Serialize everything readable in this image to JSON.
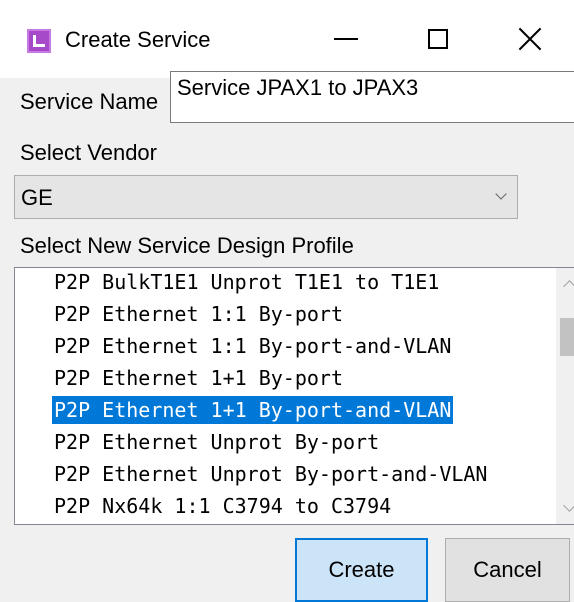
{
  "window": {
    "title": "Create Service",
    "icon": "app-icon"
  },
  "form": {
    "service_name_label": "Service Name",
    "service_name_value": "Service JPAX1 to JPAX3",
    "vendor_label": "Select Vendor",
    "vendor_value": "GE",
    "profile_label": "Select New Service Design Profile"
  },
  "profiles": [
    "P2P BulkT1E1 Unprot T1E1 to T1E1",
    "P2P Ethernet 1:1 By-port",
    "P2P Ethernet 1:1 By-port-and-VLAN",
    "P2P Ethernet 1+1 By-port",
    "P2P Ethernet 1+1 By-port-and-VLAN",
    "P2P Ethernet Unprot By-port",
    "P2P Ethernet Unprot By-port-and-VLAN",
    "P2P Nx64k 1:1 C3794 to C3794"
  ],
  "selected_profile_index": 4,
  "buttons": {
    "create": "Create",
    "cancel": "Cancel"
  },
  "colors": {
    "selection": "#0078d7",
    "accent_button": "#cce4f7"
  }
}
